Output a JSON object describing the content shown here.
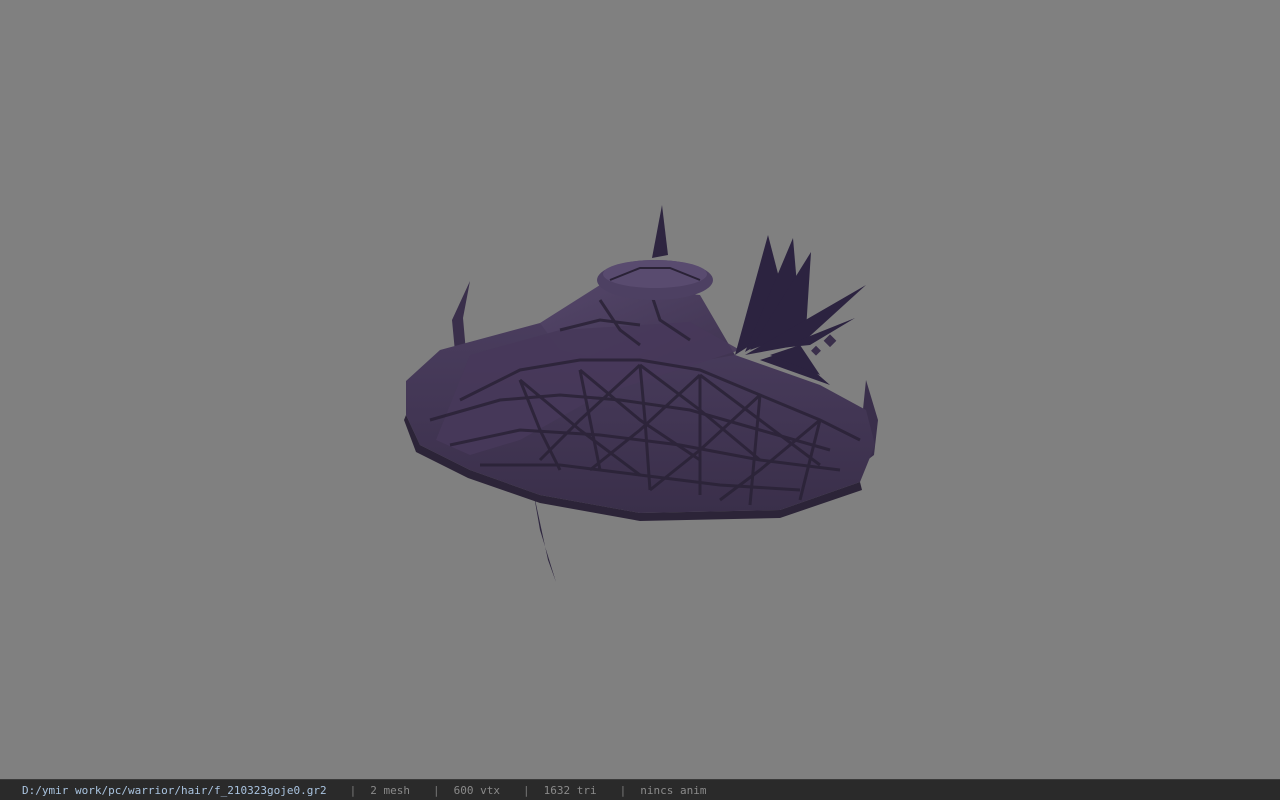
{
  "viewport": {
    "background_color": "#808080",
    "model_color": "#3f3350",
    "model_highlight": "#584a6c",
    "model_shadow": "#2a2236"
  },
  "status_bar": {
    "file_path": "D:/ymir work/pc/warrior/hair/f_210323goje0.gr2",
    "separator": "|",
    "mesh_count": "2 mesh",
    "vertex_count": "600 vtx",
    "triangle_count": "1632 tri",
    "anim_status": "nincs anim",
    "path_color": "#a9c3df"
  }
}
